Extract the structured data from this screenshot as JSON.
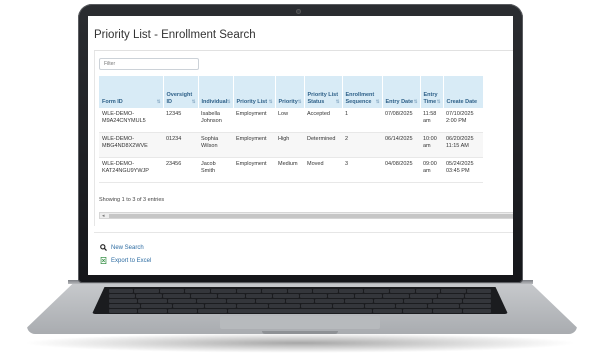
{
  "app": {
    "title": "Priority List - Enrollment Search"
  },
  "filter": {
    "placeholder": "Filter"
  },
  "table": {
    "columns": [
      "Form ID",
      "Oversight ID",
      "Individual",
      "Priority List",
      "Priority",
      "Priority List Status",
      "Enrollment Sequence",
      "Entry Date",
      "Entry Time",
      "Create Date"
    ],
    "rows": [
      [
        "WLE-DEMO-M9A24CNYMUL5",
        "12345",
        "Isabella Johnson",
        "Employment",
        "Low",
        "Accepted",
        "1",
        "07/08/2025",
        "11:58 am",
        "07/10/2025 2:00 PM"
      ],
      [
        "WLE-DEMO-MBG4ND8X2WVE",
        "01234",
        "Sophia Wilson",
        "Employment",
        "High",
        "Determined",
        "2",
        "06/14/2025",
        "10:00 am",
        "06/20/2025 11:15 AM"
      ],
      [
        "WLE-DEMO-KAT24NGU9YWJP",
        "23456",
        "Jacob Smith",
        "Employment",
        "Medium",
        "Moved",
        "3",
        "04/08/2025",
        "09:00 am",
        "05/24/2025 03:45 PM"
      ]
    ],
    "sort_glyph": "⇅"
  },
  "info": "Showing 1 to 3 of 3 entries",
  "actions": {
    "new_search": "New Search",
    "export": "Export to Excel"
  },
  "colors": {
    "header_bg": "#d8ebf6",
    "header_text": "#2d5f87",
    "link": "#2d6ca2",
    "excel_green": "#2e8b3e"
  },
  "icons": {
    "new_search": "search-icon",
    "export": "excel-icon",
    "scroll_left": "scroll-left-arrow"
  }
}
